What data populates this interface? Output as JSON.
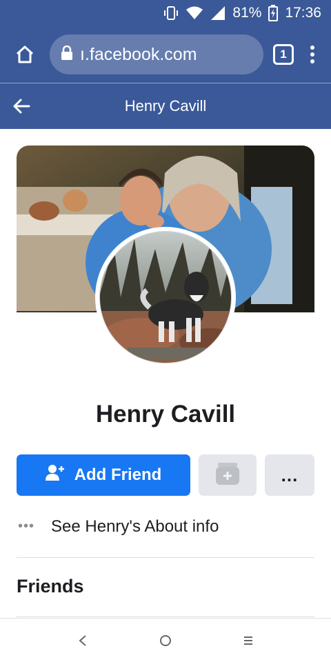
{
  "status_bar": {
    "battery_percent": "81%",
    "time": "17:36",
    "icons": [
      "vibrate-icon",
      "wifi-icon",
      "signal-icon",
      "battery-charging-icon"
    ]
  },
  "browser": {
    "url": "ı.facebook.com",
    "tab_count": "1",
    "icons": [
      "home-icon",
      "lock-icon",
      "tabs-icon",
      "overflow-menu-icon"
    ]
  },
  "page_header": {
    "title": "Henry Cavill",
    "back_icon": "back-arrow-icon"
  },
  "profile": {
    "name": "Henry Cavill",
    "cover_photo": "cover-photo",
    "profile_picture": "profile-picture"
  },
  "actions": {
    "add_friend_label": "Add Friend",
    "add_friend_icon": "add-person-icon",
    "message_icon": "messenger-disabled-icon",
    "more_label": "..."
  },
  "about": {
    "dots": "•••",
    "label": "See Henry's About info"
  },
  "friends": {
    "heading": "Friends"
  },
  "nav_bar": {
    "icons": [
      "back-nav-icon",
      "home-nav-icon",
      "recents-nav-icon"
    ]
  },
  "colors": {
    "brand_blue": "#3b5998",
    "primary_button": "#1877f2",
    "secondary_button": "#e4e6eb",
    "text": "#1c1e21",
    "muted": "#8a8d91"
  }
}
